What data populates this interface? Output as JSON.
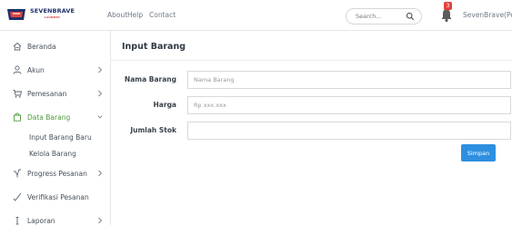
{
  "brand": {
    "name": "SEVENBRAVE",
    "sub": "LAUNDRY"
  },
  "topnav": {
    "about": "About",
    "help": "Help",
    "contact": "Contact"
  },
  "search": {
    "placeholder": "Search..."
  },
  "notifications": {
    "count": "3"
  },
  "user": {
    "name": "SevenBrave(Pemilik"
  },
  "sidebar": {
    "items": [
      {
        "label": "Beranda",
        "icon": "home-icon"
      },
      {
        "label": "Akun",
        "icon": "user-icon"
      },
      {
        "label": "Pemesanan",
        "icon": "cart-icon"
      },
      {
        "label": "Data Barang",
        "icon": "bag-icon"
      },
      {
        "label": "Progress Pesanan",
        "icon": "progress-icon"
      },
      {
        "label": "Verifikasi Pesanan",
        "icon": "check-icon"
      },
      {
        "label": "Laporan",
        "icon": "report-icon"
      }
    ],
    "submenu": [
      "Input Barang Baru",
      "Kelola Barang"
    ]
  },
  "page": {
    "title": "Input Barang",
    "fields": {
      "nama_barang": {
        "label": "Nama Barang",
        "placeholder": "Nama Barang",
        "value": ""
      },
      "harga": {
        "label": "Harga",
        "placeholder": "Rp xxx.xxx",
        "value": ""
      },
      "jumlah_stok": {
        "label": "Jumlah Stok",
        "placeholder": "",
        "value": ""
      }
    },
    "submit_label": "Simpan"
  },
  "colors": {
    "active_green": "#4e9b3f",
    "primary_blue": "#2e8fe0",
    "badge_red": "#e0433b"
  }
}
